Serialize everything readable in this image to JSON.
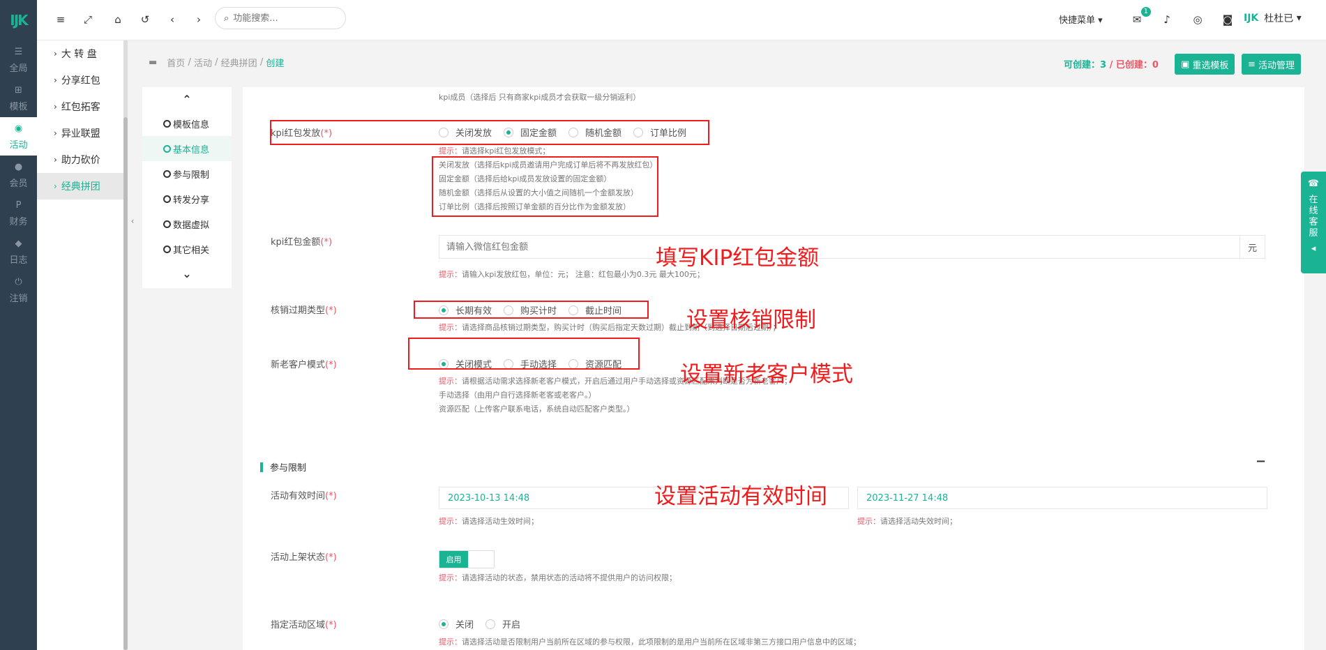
{
  "rail": {
    "logo": "IJK",
    "items": [
      {
        "label": "全局",
        "icon": "sliders-icon"
      },
      {
        "label": "模板",
        "icon": "sitemap-icon"
      },
      {
        "label": "活动",
        "icon": "map-pin-icon"
      },
      {
        "label": "会员",
        "icon": "users-icon"
      },
      {
        "label": "财务",
        "icon": "paypal-icon"
      },
      {
        "label": "日志",
        "icon": "shield-icon"
      },
      {
        "label": "注销",
        "icon": "power-icon"
      }
    ]
  },
  "submenu": {
    "items": [
      "大 转 盘",
      "分享红包",
      "红包拓客",
      "异业联盟",
      "助力砍价",
      "经典拼团"
    ]
  },
  "topbar": {
    "search_placeholder": "功能搜索...",
    "quick_menu": "快捷菜单",
    "mail_badge": "1",
    "username": "杜杜已"
  },
  "breadcrumb": {
    "home": "首页",
    "activity": "活动",
    "group": "经典拼团",
    "current": "创建",
    "sep": "/"
  },
  "counts": {
    "can_create_label": "可创建：",
    "can_create": "3",
    "sep": " / ",
    "created_label": "已创建：",
    "created": "0"
  },
  "buttons": {
    "reselect": "重选模板",
    "manage": "活动管理"
  },
  "steps": [
    "模板信息",
    "基本信息",
    "参与限制",
    "转发分享",
    "数据虚拟",
    "其它相关"
  ],
  "form": {
    "top_hint": "kpi成员（选择后 只有商家kpi成员才会获取一级分销返利）",
    "kpi_mode": {
      "label": "kpi红包发放",
      "req": "(*)",
      "options": [
        "关闭发放",
        "固定金额",
        "随机金额",
        "订单比例"
      ],
      "hint_prefix": "提示：",
      "hint": "请选择kpi红包发放模式；",
      "hint_lines": [
        "关闭发放（选择后kpi成员邀请用户完成订单后将不再发放红包）",
        "固定金额（选择后给kpi成员发放设置的固定金额）",
        "随机金额（选择后从设置的大小值之间随机一个金额发放）",
        "订单比例（选择后按照订单金额的百分比作为金额发放）"
      ]
    },
    "kpi_amount": {
      "label": "kpi红包金额",
      "req": "(*)",
      "placeholder": "请输入微信红包金额",
      "unit": "元",
      "hint_prefix": "提示：",
      "hint": "请输入kpi发放红包，单位：元； 注意：红包最小为0.3元 最大100元；"
    },
    "expire_type": {
      "label": "核销过期类型",
      "req": "(*)",
      "options": [
        "长期有效",
        "购买计时",
        "截止时间"
      ],
      "hint_prefix": "提示：",
      "hint": "请选择商品核销过期类型，购买计时（购买后指定天数过期）截止到期（到选择日期后过期）；"
    },
    "customer_mode": {
      "label": "新老客户模式",
      "req": "(*)",
      "options": [
        "关闭模式",
        "手动选择",
        "资源匹配"
      ],
      "hint_prefix": "提示：",
      "hint": "请根据活动需求选择新老客户模式，开启后通过用户手动选择或资源匹配来判断是否为新老客户；",
      "hint_lines": [
        "手动选择（由用户自行选择新老客或老客户。）",
        "资源匹配（上传客户联系电话，系统自动匹配客户类型。）"
      ]
    },
    "section": {
      "title": "参与限制",
      "collapse": "−"
    },
    "valid_time": {
      "label": "活动有效时间",
      "req": "(*)",
      "start": "2023-10-13 14:48",
      "end": "2023-11-27 14:48",
      "start_hint_prefix": "提示：",
      "start_hint": "请选择活动生效时间；",
      "end_hint_prefix": "提示：",
      "end_hint": "请选择活动失效时间；"
    },
    "status": {
      "label": "活动上架状态",
      "req": "(*)",
      "toggle": "启用",
      "hint_prefix": "提示：",
      "hint": "请选择活动的状态，禁用状态的活动将不提供用户的访问权限；"
    },
    "region": {
      "label": "指定活动区域",
      "req": "(*)",
      "options": [
        "关闭",
        "开启"
      ],
      "hint_prefix": "提示：",
      "hint": "请选择活动是否限制用户当前所在区域的参与权限，此项限制的是用户当前所在区域非第三方接口用户信息中的区域；"
    }
  },
  "annotations": {
    "amount": "填写KIP红包金额",
    "expire": "设置核销限制",
    "customer": "设置新老客户模式",
    "time": "设置活动有效时间"
  },
  "customer_service": "在线客服",
  "colors": {
    "brand": "#1ab394",
    "danger": "#ed5565",
    "annotation": "#ee1c1c",
    "rail": "#2f4050"
  }
}
